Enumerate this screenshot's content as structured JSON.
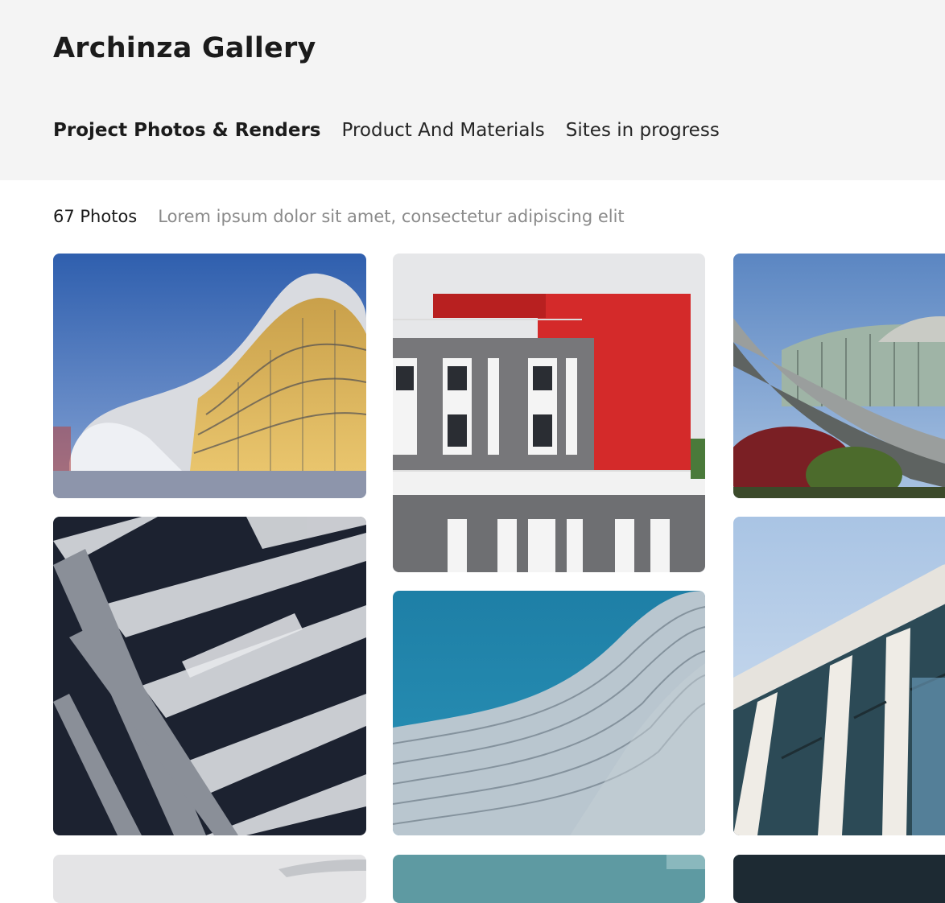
{
  "app": {
    "title": "Archinza Gallery"
  },
  "tabs": [
    {
      "label": "Project Photos & Renders",
      "active": true
    },
    {
      "label": "Product And Materials",
      "active": false
    },
    {
      "label": "Sites in progress",
      "active": false
    }
  ],
  "summary": {
    "count": "67 Photos",
    "description": "Lorem ipsum dolor sit amet, consectetur adipiscing elit"
  },
  "gallery": {
    "photos": [
      {
        "subject": "curved white building at dusk"
      },
      {
        "subject": "red and grey facade with windows"
      },
      {
        "subject": "curved glass roof with garden"
      },
      {
        "subject": "angular metallic facade"
      },
      {
        "subject": "woven aluminium facade against blue sky"
      },
      {
        "subject": "white column building against sky"
      },
      {
        "subject": "light grey building"
      },
      {
        "subject": "teal structure"
      },
      {
        "subject": "dark building"
      }
    ]
  }
}
